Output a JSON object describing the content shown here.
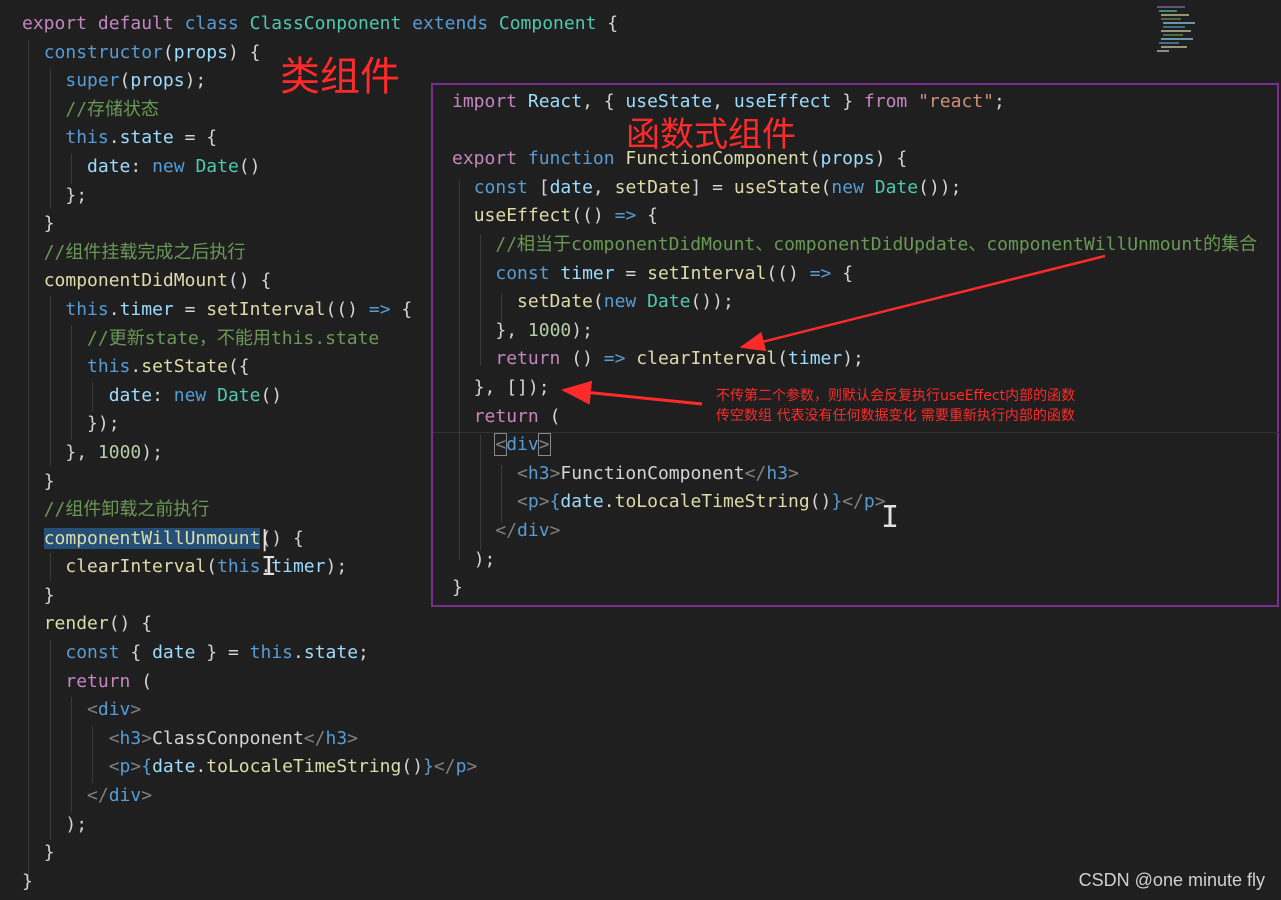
{
  "annotations": {
    "class_label": "类组件",
    "function_label": "函数式组件",
    "note_line1": "不传第二个参数，则默认会反复执行useEffect内部的函数",
    "note_line2": "传空数组  代表没有任何数据变化  需要重新执行内部的函数"
  },
  "watermark": "CSDN @one minute fly",
  "colors": {
    "background": "#1f1f1f",
    "panel_border": "#7a2f8f",
    "annotation_red": "#ff2a2a",
    "keyword": "#569cd6",
    "control_keyword": "#c586c0",
    "class_name": "#4ec9b0",
    "function": "#dcdcaa",
    "variable": "#9cdcfe",
    "number": "#b5cea8",
    "string": "#ce9178",
    "comment": "#6a9955"
  },
  "editor_left": {
    "l01": [
      "export",
      "default",
      "class",
      "ClassConponent",
      "extends",
      "Component",
      "{"
    ],
    "l02": [
      "constructor",
      "(",
      "props",
      ")",
      "{"
    ],
    "l03": [
      "super",
      "(",
      "props",
      ");"
    ],
    "l04": "//存储状态",
    "l05": [
      "this",
      ".",
      "state",
      "=",
      "{"
    ],
    "l06": [
      "date",
      ":",
      "new",
      "Date",
      "()"
    ],
    "l07": "};",
    "l08": "}",
    "l09": "//组件挂载完成之后执行",
    "l10": [
      "componentDidMount",
      "()",
      "{"
    ],
    "l11": [
      "this",
      ".",
      "timer",
      "=",
      "setInterval",
      "(()",
      "=>",
      "{"
    ],
    "l12": "//更新state，不能用this.state",
    "l13": [
      "this",
      ".",
      "setState",
      "({"
    ],
    "l14": [
      "date",
      ":",
      "new",
      "Date",
      "()"
    ],
    "l15": "});",
    "l16": [
      "},",
      "1000",
      ");"
    ],
    "l17": "}",
    "l18": "//组件卸载之前执行",
    "l19": [
      "componentWillUnmount",
      "()",
      "{"
    ],
    "l20": [
      "clearInterval",
      "(",
      "this",
      ".",
      "timer",
      ");"
    ],
    "l21": "}",
    "l22": [
      "render",
      "()",
      "{"
    ],
    "l23": [
      "const",
      "{",
      "date",
      "}",
      "=",
      "this",
      ".",
      "state",
      ";"
    ],
    "l24": [
      "return",
      "("
    ],
    "l25": [
      "<",
      "div",
      ">"
    ],
    "l26": [
      "<",
      "h3",
      ">",
      "ClassConponent",
      "</",
      "h3",
      ">"
    ],
    "l27": [
      "<",
      "p",
      ">",
      "{",
      "date",
      ".",
      "toLocaleTimeString",
      "()",
      "}",
      "</",
      "p",
      ">"
    ],
    "l28": [
      "</",
      "div",
      ">"
    ],
    "l29": ");",
    "l30": "}",
    "l31": "}"
  },
  "editor_right": {
    "r01": [
      "import",
      "React",
      ", {",
      "useState",
      ",",
      "useEffect",
      "}",
      "from",
      "\"react\"",
      ";"
    ],
    "r03": [
      "export",
      "function",
      "FunctionComponent",
      "(",
      "props",
      ")",
      "{"
    ],
    "r04": [
      "const",
      "[",
      "date",
      ",",
      "setDate",
      "]",
      "=",
      "useState",
      "(",
      "new",
      "Date",
      "());"
    ],
    "r05": [
      "useEffect",
      "(()",
      "=>",
      "{"
    ],
    "r06": "//相当于componentDidMount、componentDidUpdate、componentWillUnmount的集合",
    "r07": [
      "const",
      "timer",
      "=",
      "setInterval",
      "(()",
      "=>",
      "{"
    ],
    "r08": [
      "setDate",
      "(",
      "new",
      "Date",
      "());"
    ],
    "r09": [
      "},",
      "1000",
      ");"
    ],
    "r10": [
      "return",
      "()",
      "=>",
      "clearInterval",
      "(",
      "timer",
      ");"
    ],
    "r11": "}, []);",
    "r12": [
      "return",
      "("
    ],
    "r13": [
      "<",
      "div",
      ">"
    ],
    "r14": [
      "<",
      "h3",
      ">",
      "FunctionComponent",
      "</",
      "h3",
      ">"
    ],
    "r15": [
      "<",
      "p",
      ">",
      "{",
      "date",
      ".",
      "toLocaleTimeString",
      "()",
      "}",
      "</",
      "p",
      ">"
    ],
    "r16": [
      "</",
      "div",
      ">"
    ],
    "r17": ");",
    "r18": "}"
  }
}
